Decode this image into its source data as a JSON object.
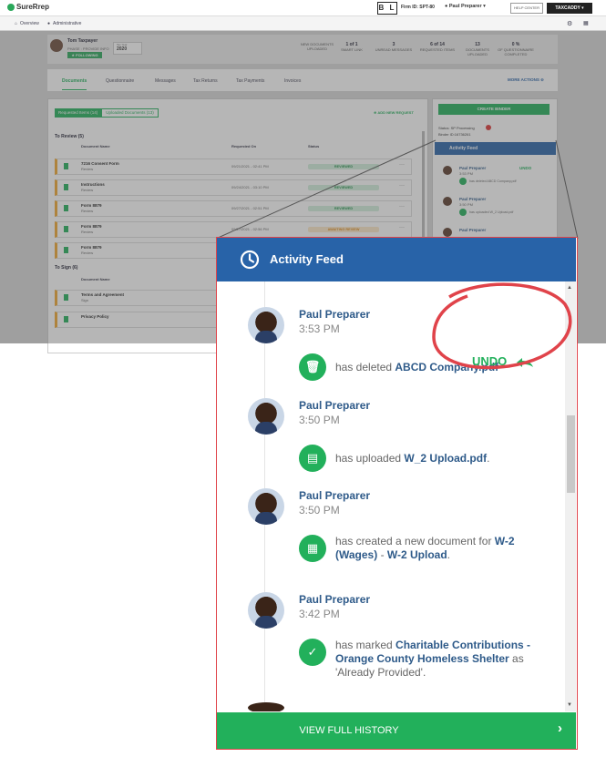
{
  "header": {
    "brand": "SureRrep",
    "logo_mark": "B L",
    "firm_id": "Firm ID: SPT-80",
    "user": "Paul Preparer",
    "help_label": "HELP CENTER",
    "taxcaddy_label": "TAXCADDY"
  },
  "nav": {
    "overview": "Overview",
    "administrative": "Administrative"
  },
  "client": {
    "name": "Tom Taxpayer",
    "phase": "PHASE : PROVIDE INFO",
    "following": "FOLLOWING",
    "tax_year_label": "Tax Year",
    "tax_year": "2020"
  },
  "stats": [
    {
      "value": "",
      "label": "NEW DOCUMENTS UPLOADED"
    },
    {
      "value": "1 of 1",
      "label": "SMART LINK"
    },
    {
      "value": "3",
      "label": "UNREAD MESSAGES"
    },
    {
      "value": "6 of 14",
      "label": "REQUESTED ITEMS"
    },
    {
      "value": "13",
      "label": "DOCUMENTS UPLOADED"
    },
    {
      "value": "0 %",
      "label": "OF QUESTIONNAIRE COMPLETED"
    }
  ],
  "tabs": [
    "Documents",
    "Questionnaire",
    "Messages",
    "Tax Returns",
    "Tax Payments",
    "Invoices"
  ],
  "more_actions": "MORE ACTIONS",
  "subtabs": {
    "requested": "Requested Items (14)",
    "uploaded": "Uploaded Documents (13)",
    "add": "ADD NEW REQUEST"
  },
  "to_review": {
    "heading": "To Review (5)",
    "cols": [
      "Document Name",
      "Requested On",
      "Status"
    ],
    "rows": [
      {
        "name": "7216 Consent Form",
        "sub": "Review",
        "date": "09/21/2021 - 02:41 PM",
        "status": "REVIEWED"
      },
      {
        "name": "Instructions",
        "sub": "Review",
        "date": "09/24/2021 - 03:10 PM",
        "status": "REVIEWED"
      },
      {
        "name": "Form 8879",
        "sub": "Review",
        "date": "09/27/2021 - 02:51 PM",
        "status": "REVIEWED"
      },
      {
        "name": "Form 8879",
        "sub": "Review",
        "date": "09/27/2021 - 02:56 PM",
        "status": "AWAITING REVIEW"
      },
      {
        "name": "Form 8879",
        "sub": "Review",
        "date": "",
        "status": ""
      }
    ]
  },
  "to_sign": {
    "heading": "To Sign (6)",
    "col": "Document Name",
    "rows": [
      {
        "name": "Terms and Agreement",
        "sub": "Sign"
      },
      {
        "name": "Privacy Policy",
        "sub": ""
      }
    ]
  },
  "side": {
    "create_binder": "CREATE BINDER",
    "status": "Status: SP Processing",
    "binder": "Binder ID:16736261",
    "feed": "Activity Feed",
    "mini": [
      {
        "name": "Paul Preparer",
        "time": "3:53 PM",
        "text": "has deleted ABCD Company.pdf",
        "undo": "UNDO"
      },
      {
        "name": "Paul Preparer",
        "time": "3:50 PM",
        "text": "has uploaded W_2 Upload.pdf"
      },
      {
        "name": "Paul Preparer",
        "time": ""
      }
    ]
  },
  "popup": {
    "title": "Activity Feed",
    "undo": "UNDO",
    "footer": "VIEW FULL HISTORY",
    "items": [
      {
        "name": "Paul Preparer",
        "time": "3:53 PM",
        "pre": "has deleted ",
        "link1": "ABCD Company.pdf",
        "mid": "",
        "link2": "",
        "post": ""
      },
      {
        "name": "Paul Preparer",
        "time": "3:50 PM",
        "pre": "has uploaded ",
        "link1": "W_2 Upload.pdf",
        "mid": "",
        "link2": "",
        "post": "."
      },
      {
        "name": "Paul Preparer",
        "time": "3:50 PM",
        "pre": "has created a new document for ",
        "link1": "W-2 (Wages)",
        "mid": " - ",
        "link2": "W-2 Upload",
        "post": "."
      },
      {
        "name": "Paul Preparer",
        "time": "3:42 PM",
        "pre": "has marked ",
        "link1": "Charitable Contributions - Orange County Homeless Shelter",
        "mid": "",
        "link2": "",
        "post": " as 'Already Provided'."
      }
    ]
  }
}
